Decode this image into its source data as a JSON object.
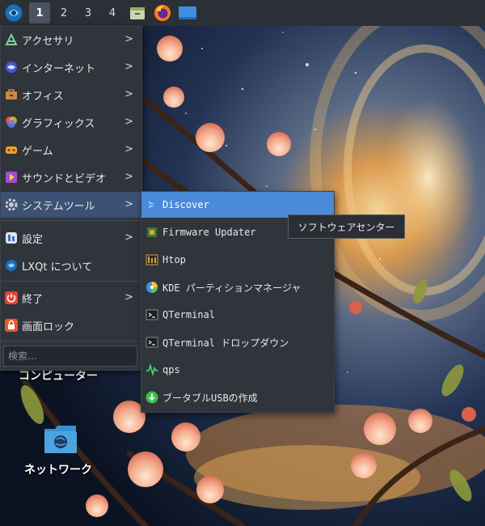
{
  "taskbar": {
    "workspaces": [
      "1",
      "2",
      "3",
      "4"
    ],
    "active_workspace": "1",
    "apps": [
      "file-manager-icon",
      "firefox-icon",
      "desktop-icon"
    ]
  },
  "main_menu": {
    "items": [
      {
        "label": "アクセサリ",
        "icon": "accessories-icon"
      },
      {
        "label": "インターネット",
        "icon": "internet-icon"
      },
      {
        "label": "オフィス",
        "icon": "office-icon"
      },
      {
        "label": "グラフィックス",
        "icon": "graphics-icon"
      },
      {
        "label": "ゲーム",
        "icon": "games-icon"
      },
      {
        "label": "サウンドとビデオ",
        "icon": "multimedia-icon"
      },
      {
        "label": "システムツール",
        "icon": "system-tools-icon"
      },
      {
        "label": "設定",
        "icon": "settings-icon"
      },
      {
        "label": "LXQt について",
        "icon": "lxqt-icon"
      },
      {
        "label": "終了",
        "icon": "shutdown-icon"
      },
      {
        "label": "画面ロック",
        "icon": "lock-icon"
      }
    ],
    "submenu_arrow": ">",
    "search_placeholder": "検索..."
  },
  "system_tools_menu": {
    "items": [
      {
        "label": "Discover",
        "icon": "discover-icon"
      },
      {
        "label": "Firmware Updater",
        "icon": "firmware-icon"
      },
      {
        "label": "Htop",
        "icon": "htop-icon"
      },
      {
        "label": "KDE パーティションマネージャ",
        "icon": "partition-manager-icon"
      },
      {
        "label": "QTerminal",
        "icon": "terminal-icon"
      },
      {
        "label": "QTerminal ドロップダウン",
        "icon": "terminal-icon"
      },
      {
        "label": "qps",
        "icon": "qps-icon"
      },
      {
        "label": "ブータブルUSBの作成",
        "icon": "usb-creator-icon"
      }
    ]
  },
  "tooltip": "ソフトウェアセンター",
  "desktop": {
    "computer_label": "コンピューター",
    "network_label": "ネットワーク"
  },
  "colors": {
    "menu_bg": "#30343b",
    "highlight": "#4a8ad8",
    "category_highlight": "#3c5173",
    "taskbar_bg": "#2b2f36"
  }
}
